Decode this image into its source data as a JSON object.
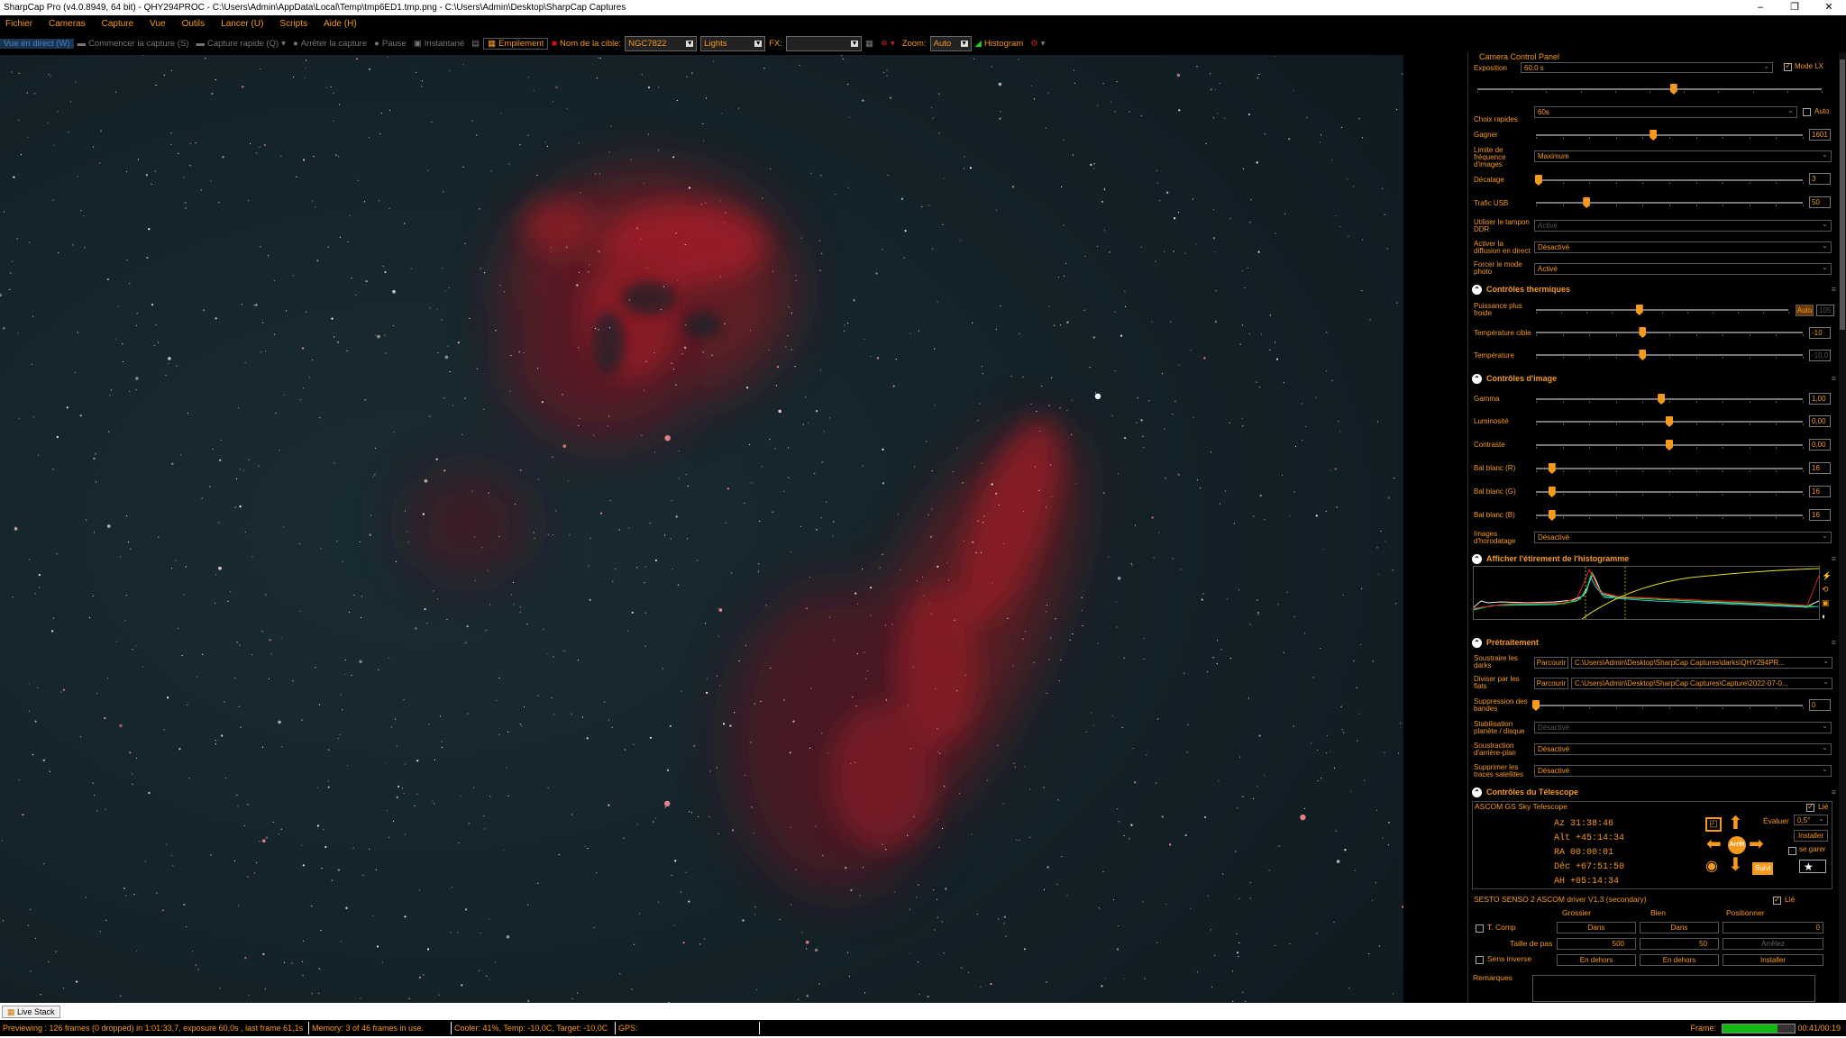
{
  "window": {
    "title": "SharpCap Pro (v4.0.8949, 64 bit) - QHY294PROC - C:\\Users\\Admin\\AppData\\Local\\Temp\\tmp6ED1.tmp.png - C:\\Users\\Admin\\Desktop\\SharpCap Captures",
    "minimize": "–",
    "maximize": "❐",
    "close": "✕"
  },
  "menu": [
    "Fichier",
    "Cameras",
    "Capture",
    "Vue",
    "Outils",
    "Lancer (U)",
    "Scripts",
    "Aide (H)"
  ],
  "toolbar": {
    "live_view": "Vue en direct (W)",
    "start_capture": "Commencer la capture (S)",
    "quick_capture": "Capture rapide (Q)",
    "stop_capture": "Arrêter la capture",
    "pause": "Pause",
    "snapshot": "Instantané",
    "stacking": "Empilement",
    "target_label": "Nom de la cible:",
    "target_value": "NGC7822",
    "frame_type": "Lights",
    "fx_label": "FX:",
    "fx_value": "",
    "zoom_label": "Zoom:",
    "zoom_value": "Auto",
    "histogram": "Histogram"
  },
  "panel": {
    "title": "Camera Control Panel",
    "exposure": {
      "label": "Exposition",
      "value": "60,0 s",
      "mode_lx_label": "Mode LX",
      "mode_lx": true,
      "slider": 0.57
    },
    "quick_choice": {
      "label": "Choix rapides",
      "value": "60s",
      "auto_label": "Auto"
    },
    "gain": {
      "label": "Gagner",
      "value": "1601",
      "slider": 0.44
    },
    "frame_rate_limit": {
      "label": "Limite de fréquence d'images",
      "value": "Maximum"
    },
    "offset": {
      "label": "Décalage",
      "value": "3",
      "slider": 0.01
    },
    "usb_traffic": {
      "label": "Trafic USB",
      "value": "50",
      "slider": 0.19
    },
    "ddr_buffer": {
      "label": "Utiliser le tampon DDR",
      "value": "Activé"
    },
    "live_broadcast": {
      "label": "Activer la diffusion en direct",
      "value": "Désactivé"
    },
    "force_photo": {
      "label": "Forcer le mode photo",
      "value": "Activé"
    },
    "thermal": {
      "header": "Contrôles thermiques",
      "cooler_power": {
        "label": "Puissance plus froide",
        "auto": "Auto",
        "value": "105",
        "slider": 0.41
      },
      "target_temp": {
        "label": "Température cible",
        "value": "-10",
        "slider": 0.4
      },
      "temperature": {
        "label": "Température",
        "value": "-10,0",
        "slider": 0.4
      }
    },
    "image": {
      "header": "Contrôles d'image",
      "gamma": {
        "label": "Gamma",
        "value": "1,00",
        "slider": 0.47
      },
      "brightness": {
        "label": "Luminosité",
        "value": "0,00",
        "slider": 0.5
      },
      "contrast": {
        "label": "Contraste",
        "value": "0,00",
        "slider": 0.5
      },
      "wb_r": {
        "label": "Bal blanc (R)",
        "value": "16",
        "slider": 0.06
      },
      "wb_g": {
        "label": "Bal blanc (G)",
        "value": "16",
        "slider": 0.06
      },
      "wb_b": {
        "label": "Bal blanc (B)",
        "value": "16",
        "slider": 0.06
      },
      "timestamp": {
        "label": "Images d'horodatage",
        "value": "Désactivé"
      }
    },
    "histogram_section": {
      "header": "Afficher l'étirement de l'histogramme"
    },
    "preprocessing": {
      "header": "Prétraitement",
      "darks": {
        "label": "Soustraire les darks",
        "browse": "Parcourir",
        "value": "C:\\Users\\Admin\\Desktop\\SharpCap Captures\\darks\\QHY294PR..."
      },
      "flats": {
        "label": "Diviser par les flats",
        "browse": "Parcourir",
        "value": "C:\\Users\\Admin\\Desktop\\SharpCap Captures\\Capture\\2022-07-0..."
      },
      "banding": {
        "label": "Suppression des bandes",
        "value": "0",
        "slider": 0.0
      },
      "stabilization": {
        "label": "Stabilisation planète / disque",
        "value": "Désactivé"
      },
      "background": {
        "label": "Soustraction d'arrière-plan",
        "value": "Désactivé"
      },
      "satellites": {
        "label": "Supprimer les traces satellites",
        "value": "Désactivé"
      }
    },
    "telescope": {
      "header": "Contrôles du Télescope",
      "mount": "ASCOM GS Sky Telescope",
      "linked_label": "Lié",
      "az": "Az 31:38:46",
      "alt": "Alt +45:14:34",
      "ra": "RA 00:00:01",
      "dec": "Déc +67:51:50",
      "ah": "AH +05:14:34",
      "rate_label": "Évaluer",
      "rate_value": "0,5°",
      "install": "Installer",
      "park": "se garer",
      "track": "Suivi",
      "stop_center": "Arrêt"
    },
    "focuser": {
      "name": "SESTO SENSO 2 ASCOM driver V1.3 (secondary)",
      "linked_label": "Lié",
      "coarse": "Grossier",
      "fine": "Bien",
      "position": "Positionner",
      "tcomp": "T. Comp",
      "in1": "Dans",
      "in2": "Dans",
      "pos_value": "0",
      "step_label": "Taille de pas",
      "step_coarse": "500",
      "step_fine": "50",
      "stop": "Arrêtez",
      "reverse": "Sens inverse",
      "out1": "En dehors",
      "out2": "En dehors",
      "install": "Installer"
    },
    "remarks": "Remarques"
  },
  "footer": {
    "live_stack_tab": "Live Stack",
    "status": "Previewing : 126 frames (0 dropped) in 1:01:33,7, exposure 60,0s , last frame 61,1s",
    "memory": "Memory: 3 of 46 frames in use.",
    "cooler": "Cooler: 41%, Temp: -10,0C, Target: -10,0C",
    "gps": "GPS:",
    "frame_label": "Frame:",
    "frame_progress": 0.76,
    "elapsed": "00:41/00:19"
  },
  "colors": {
    "accent": "#f59a1b",
    "nebula": "#c2222e",
    "sky": "#14262d"
  }
}
